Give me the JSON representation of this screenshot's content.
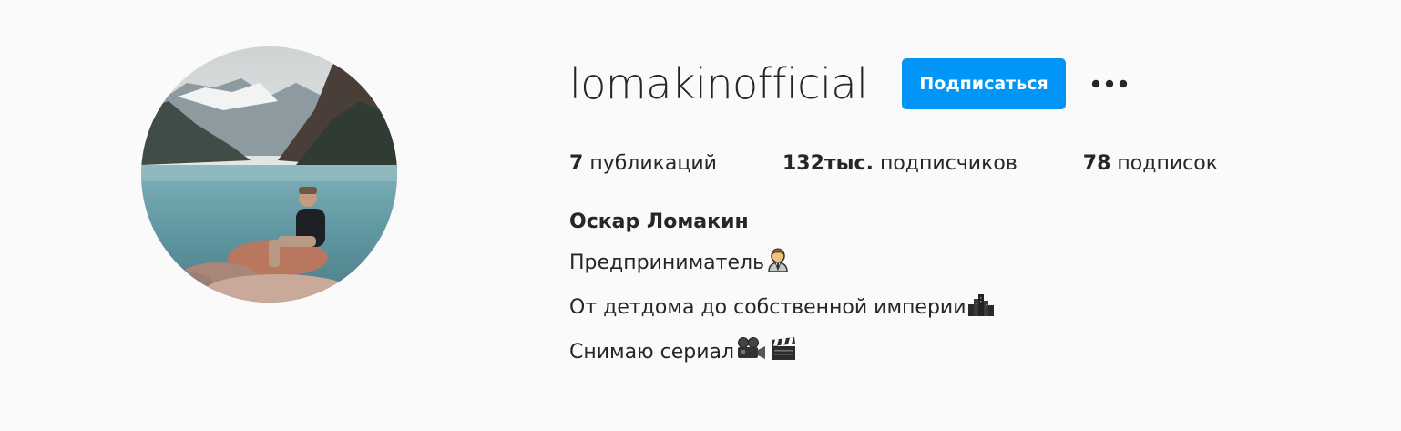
{
  "profile": {
    "username": "lomakinofficial",
    "follow_label": "Подписаться",
    "more_label": "•••",
    "stats": {
      "posts_count": "7",
      "posts_label": "публикаций",
      "followers_count": "132тыс.",
      "followers_label": "подписчиков",
      "following_count": "78",
      "following_label": "подписок"
    },
    "full_name": "Оскар Ломакин",
    "bio_lines": [
      {
        "text": "Предприниматель",
        "emoji": "man-office-worker-icon"
      },
      {
        "text": "От детдома до собственной империи",
        "emoji": "cityscape-icon"
      },
      {
        "text": "Снимаю сериал",
        "emoji": "movie-camera-icon clapper-board-icon"
      }
    ]
  },
  "colors": {
    "background": "#fafafa",
    "text": "#262626",
    "accent": "#0095f6"
  }
}
